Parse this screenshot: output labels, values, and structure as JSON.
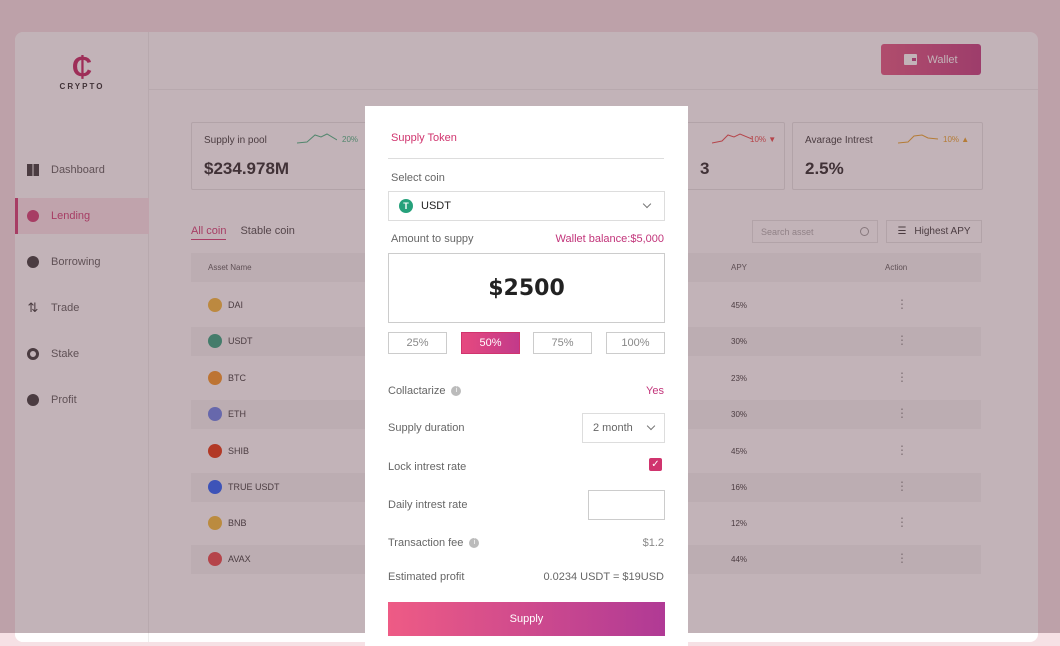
{
  "logo": {
    "mark": "₵",
    "text": "CRYPTO"
  },
  "sidebar": {
    "items": [
      {
        "label": "Dashboard",
        "icon": "dashboard-icon"
      },
      {
        "label": "Lending",
        "icon": "lending-icon"
      },
      {
        "label": "Borrowing",
        "icon": "borrowing-icon"
      },
      {
        "label": "Trade",
        "icon": "trade-icon"
      },
      {
        "label": "Stake",
        "icon": "stake-icon"
      },
      {
        "label": "Profit",
        "icon": "profit-icon"
      }
    ]
  },
  "header": {
    "wallet_label": "Wallet"
  },
  "cards": [
    {
      "label": "Supply in pool",
      "value": "$234.978M",
      "pct": "20%"
    },
    {
      "label": "",
      "value": "3",
      "pct": "10% ▼"
    },
    {
      "label": "Avarage Intrest",
      "value": "2.5%",
      "pct": "10% ▲"
    }
  ],
  "tabs": [
    "All coin",
    "Stable coin"
  ],
  "search": {
    "placeholder": "Search asset"
  },
  "filter_label": "Highest APY",
  "table": {
    "headers": {
      "asset": "Asset Name",
      "apy": "APY",
      "action": "Action"
    },
    "rows": [
      {
        "name": "DAI",
        "apy": "45%",
        "color": "#f4b731"
      },
      {
        "name": "USDT",
        "apy": "30%",
        "color": "#26a17b"
      },
      {
        "name": "BTC",
        "apy": "23%",
        "color": "#f7931a"
      },
      {
        "name": "ETH",
        "apy": "30%",
        "color": "#627eea"
      },
      {
        "name": "SHIB",
        "apy": "45%",
        "color": "#e42d04"
      },
      {
        "name": "TRUE USDT",
        "apy": "16%",
        "color": "#1a5aff"
      },
      {
        "name": "BNB",
        "apy": "12%",
        "color": "#f3ba2f"
      },
      {
        "name": "AVAX",
        "apy": "44%",
        "color": "#e84142"
      }
    ]
  },
  "modal": {
    "title": "Supply Token",
    "select_coin_label": "Select coin",
    "selected_coin": "USDT",
    "amount_label": "Amount to suppy",
    "wallet_balance": "Wallet balance:$5,000",
    "amount": "$2500",
    "percentages": [
      "25%",
      "50%",
      "75%",
      "100%"
    ],
    "active_percentage": "50%",
    "collateralize_label": "Collactarize",
    "collateralize_value": "Yes",
    "duration_label": "Supply duration",
    "duration_value": "2 month",
    "lock_label": "Lock intrest rate",
    "lock_checked": true,
    "daily_label": "Daily intrest rate",
    "fee_label": "Transaction fee",
    "fee_value": "$1.2",
    "profit_label": "Estimated profit",
    "profit_value": "0.0234 USDT = $19USD",
    "supply_button": "Supply"
  }
}
